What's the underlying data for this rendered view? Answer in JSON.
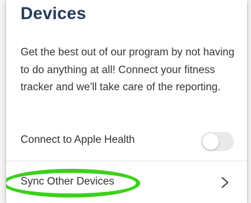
{
  "page": {
    "title": "Devices",
    "description": "Get the best out of our program by not having to do anything at all! Connect your fitness tracker and we'll take care of the reporting."
  },
  "rows": {
    "apple_health": {
      "label": "Connect to Apple Health",
      "toggle_on": false
    },
    "sync_devices": {
      "label": "Sync Other Devices",
      "icon": "chevron-right-icon"
    }
  },
  "colors": {
    "title": "#233b56",
    "highlight": "#3bd01c",
    "toggle_off": "#e9e9eb"
  }
}
